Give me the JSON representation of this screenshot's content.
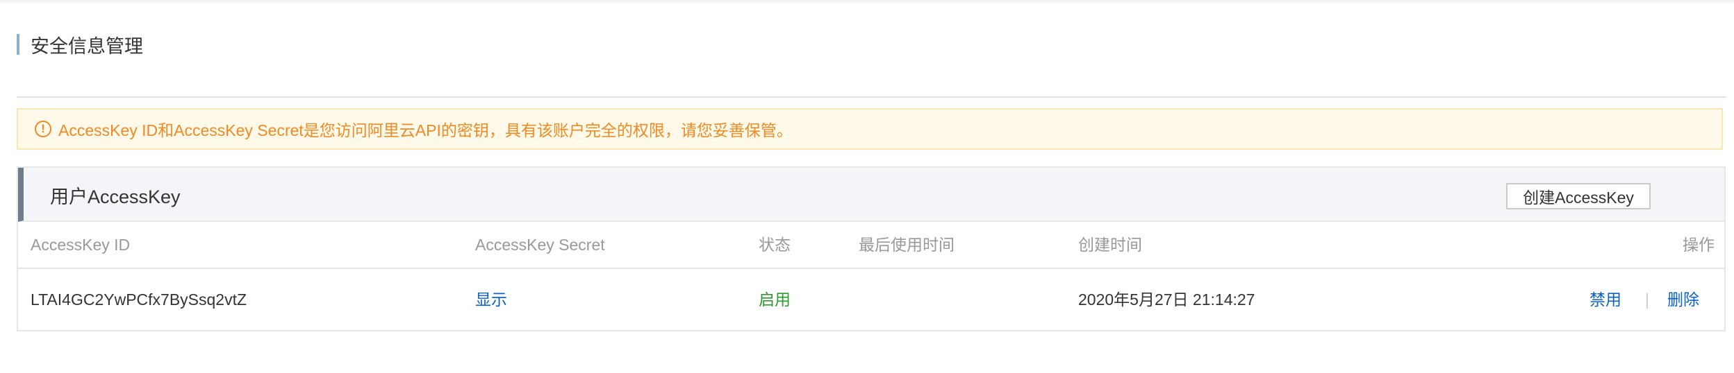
{
  "page": {
    "title": "安全信息管理"
  },
  "alert": {
    "icon": "exclamation-circle-icon",
    "text": "AccessKey ID和AccessKey Secret是您访问阿里云API的密钥，具有该账户完全的权限，请您妥善保管。",
    "color": "#f08a24"
  },
  "panel": {
    "title": "用户AccessKey",
    "create_button": "创建AccessKey"
  },
  "table": {
    "headers": {
      "id": "AccessKey ID",
      "secret": "AccessKey Secret",
      "status": "状态",
      "last_used": "最后使用时间",
      "created": "创建时间",
      "actions": "操作"
    },
    "rows": [
      {
        "id": "LTAI4GC2YwPCfx7BySsq2vtZ",
        "secret_action": "显示",
        "status": "启用",
        "last_used": "",
        "created": "2020年5月27日 21:14:27",
        "action_disable": "禁用",
        "action_separator": "|",
        "action_delete": "删除"
      }
    ]
  },
  "colors": {
    "link": "#0b63c4",
    "status_enabled": "#2c9c2c",
    "header_text": "#999999"
  }
}
